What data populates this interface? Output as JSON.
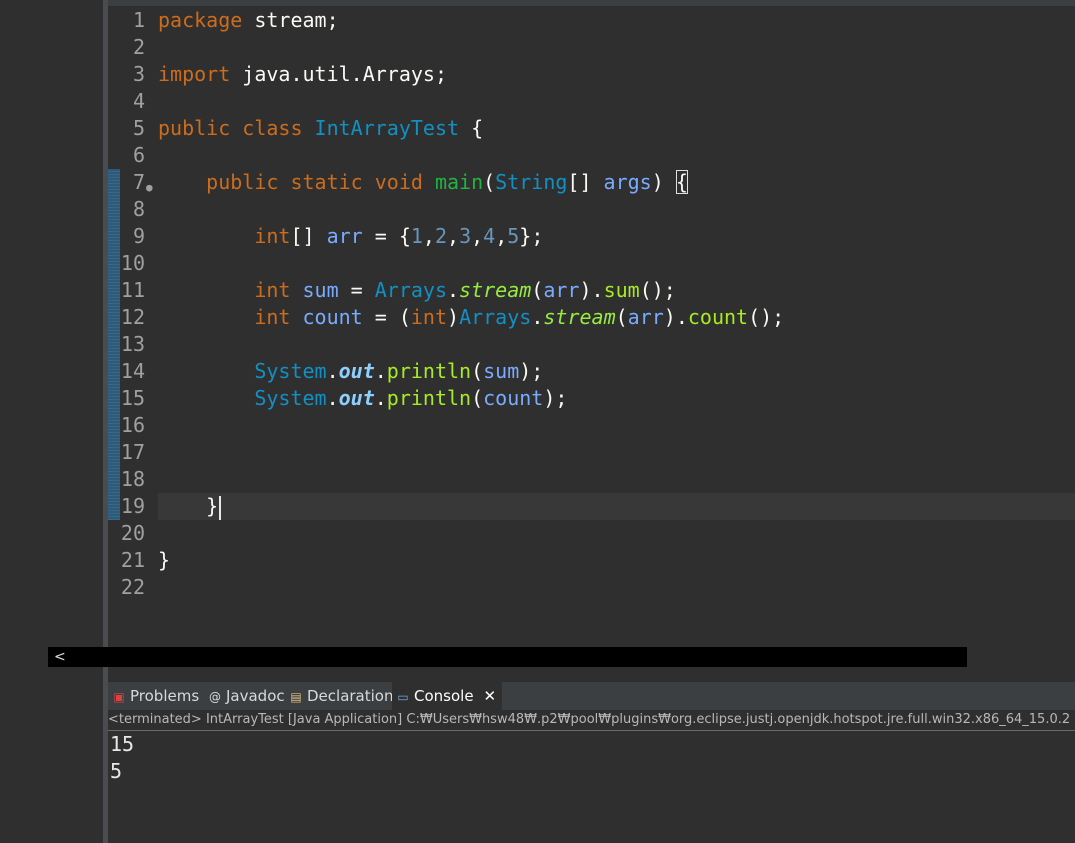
{
  "editor": {
    "lines": [
      {
        "n": "1",
        "tokens": [
          {
            "t": "package",
            "c": "kw"
          },
          {
            "t": " stream;",
            "c": "pun"
          }
        ]
      },
      {
        "n": "2",
        "tokens": []
      },
      {
        "n": "3",
        "tokens": [
          {
            "t": "import",
            "c": "kw"
          },
          {
            "t": " java.util.Arrays;",
            "c": "pun"
          }
        ]
      },
      {
        "n": "4",
        "tokens": []
      },
      {
        "n": "5",
        "tokens": [
          {
            "t": "public class ",
            "c": "kw"
          },
          {
            "t": "IntArrayTest",
            "c": "cls"
          },
          {
            "t": " {",
            "c": "pun"
          }
        ]
      },
      {
        "n": "6",
        "tokens": []
      },
      {
        "n": "7",
        "tokens": [
          {
            "t": "    public static void ",
            "c": "kw"
          },
          {
            "t": "main",
            "c": "mth"
          },
          {
            "t": "(",
            "c": "pun"
          },
          {
            "t": "String",
            "c": "cls"
          },
          {
            "t": "[] ",
            "c": "pun"
          },
          {
            "t": "args",
            "c": "par"
          },
          {
            "t": ") ",
            "c": "pun"
          },
          {
            "t": "{",
            "c": "pun brace-box"
          }
        ],
        "fold": true
      },
      {
        "n": "8",
        "tokens": []
      },
      {
        "n": "9",
        "tokens": [
          {
            "t": "        int",
            "c": "kw"
          },
          {
            "t": "[] ",
            "c": "pun"
          },
          {
            "t": "arr",
            "c": "par"
          },
          {
            "t": " = {",
            "c": "pun"
          },
          {
            "t": "1",
            "c": "num"
          },
          {
            "t": ",",
            "c": "pun"
          },
          {
            "t": "2",
            "c": "num"
          },
          {
            "t": ",",
            "c": "pun"
          },
          {
            "t": "3",
            "c": "num"
          },
          {
            "t": ",",
            "c": "pun"
          },
          {
            "t": "4",
            "c": "num"
          },
          {
            "t": ",",
            "c": "pun"
          },
          {
            "t": "5",
            "c": "num"
          },
          {
            "t": "};",
            "c": "pun"
          }
        ]
      },
      {
        "n": "10",
        "tokens": []
      },
      {
        "n": "11",
        "tokens": [
          {
            "t": "        int ",
            "c": "kw"
          },
          {
            "t": "sum",
            "c": "par"
          },
          {
            "t": " = ",
            "c": "pun"
          },
          {
            "t": "Arrays",
            "c": "cls"
          },
          {
            "t": ".",
            "c": "pun"
          },
          {
            "t": "stream",
            "c": "smth"
          },
          {
            "t": "(",
            "c": "pun"
          },
          {
            "t": "arr",
            "c": "par"
          },
          {
            "t": ").",
            "c": "pun"
          },
          {
            "t": "sum",
            "c": "call"
          },
          {
            "t": "();",
            "c": "pun"
          }
        ]
      },
      {
        "n": "12",
        "tokens": [
          {
            "t": "        int ",
            "c": "kw"
          },
          {
            "t": "count",
            "c": "par"
          },
          {
            "t": " = (",
            "c": "pun"
          },
          {
            "t": "int",
            "c": "kw"
          },
          {
            "t": ")",
            "c": "pun"
          },
          {
            "t": "Arrays",
            "c": "cls"
          },
          {
            "t": ".",
            "c": "pun"
          },
          {
            "t": "stream",
            "c": "smth"
          },
          {
            "t": "(",
            "c": "pun"
          },
          {
            "t": "arr",
            "c": "par"
          },
          {
            "t": ").",
            "c": "pun"
          },
          {
            "t": "count",
            "c": "call"
          },
          {
            "t": "();",
            "c": "pun"
          }
        ]
      },
      {
        "n": "13",
        "tokens": []
      },
      {
        "n": "14",
        "tokens": [
          {
            "t": "        System",
            "c": "cls"
          },
          {
            "t": ".",
            "c": "pun"
          },
          {
            "t": "out",
            "c": "sfld"
          },
          {
            "t": ".",
            "c": "pun"
          },
          {
            "t": "println",
            "c": "call"
          },
          {
            "t": "(",
            "c": "pun"
          },
          {
            "t": "sum",
            "c": "par"
          },
          {
            "t": ");",
            "c": "pun"
          }
        ]
      },
      {
        "n": "15",
        "tokens": [
          {
            "t": "        System",
            "c": "cls"
          },
          {
            "t": ".",
            "c": "pun"
          },
          {
            "t": "out",
            "c": "sfld"
          },
          {
            "t": ".",
            "c": "pun"
          },
          {
            "t": "println",
            "c": "call"
          },
          {
            "t": "(",
            "c": "pun"
          },
          {
            "t": "count",
            "c": "par"
          },
          {
            "t": ");",
            "c": "pun"
          }
        ]
      },
      {
        "n": "16",
        "tokens": []
      },
      {
        "n": "17",
        "tokens": []
      },
      {
        "n": "18",
        "tokens": []
      },
      {
        "n": "19",
        "tokens": [
          {
            "t": "    }",
            "c": "pun"
          }
        ],
        "caret": true
      },
      {
        "n": "20",
        "tokens": []
      },
      {
        "n": "21",
        "tokens": [
          {
            "t": "}",
            "c": "pun"
          }
        ]
      },
      {
        "n": "22",
        "tokens": []
      }
    ]
  },
  "scrollbar": {
    "arrow_icon": "chevron-left-icon",
    "arrow": "<"
  },
  "panel": {
    "tabs": [
      {
        "label": "Problems",
        "icon": "problems-icon",
        "active": false
      },
      {
        "label": "Javadoc",
        "icon": "javadoc-icon",
        "active": false
      },
      {
        "label": "Declaration",
        "icon": "declaration-icon",
        "active": false
      },
      {
        "label": "Console",
        "icon": "console-icon",
        "active": true
      }
    ],
    "close_label": "✕",
    "status": "<terminated> IntArrayTest [Java Application] C:₩Users₩hsw48₩.p2₩pool₩plugins₩org.eclipse.justj.openjdk.hotspot.jre.full.win32.x86_64_15.0.2",
    "output": [
      "15",
      "5"
    ]
  }
}
